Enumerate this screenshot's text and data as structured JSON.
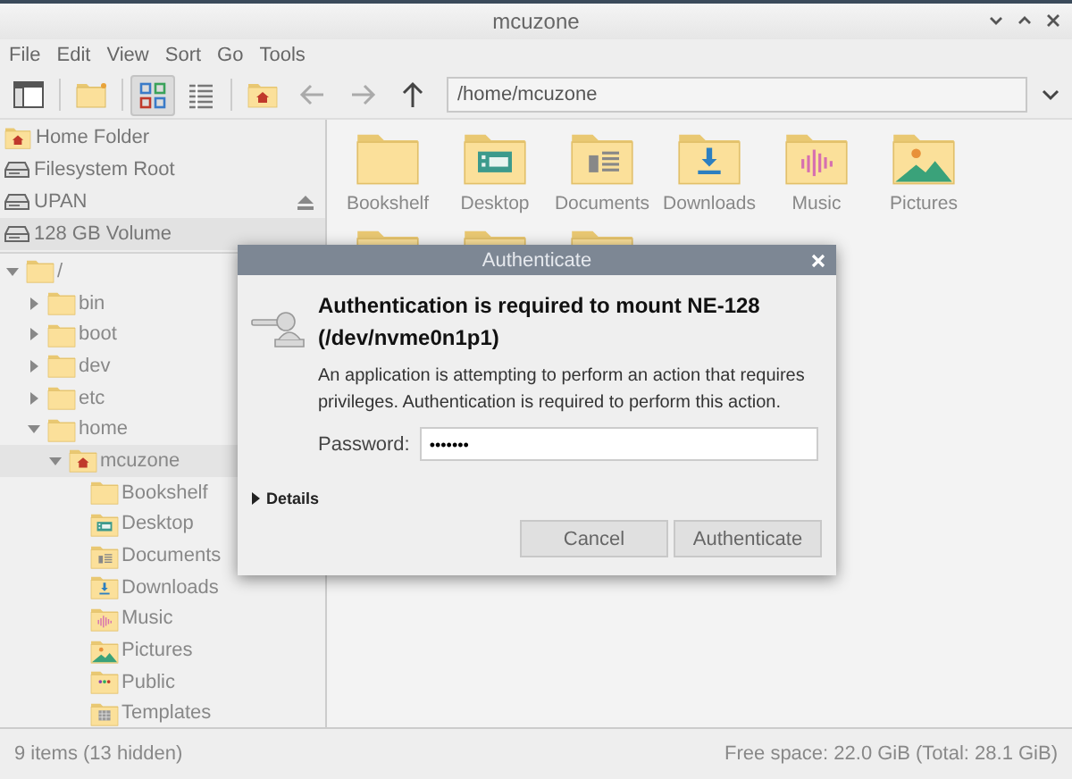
{
  "window": {
    "title": "mcuzone"
  },
  "menu": [
    "File",
    "Edit",
    "View",
    "Sort",
    "Go",
    "Tools"
  ],
  "view_modes": [
    {
      "kind": "icons",
      "selected": true
    },
    {
      "kind": "list",
      "selected": false
    }
  ],
  "nav": [
    {
      "kind": "back",
      "disabled": true
    },
    {
      "kind": "forward",
      "disabled": true
    },
    {
      "kind": "up",
      "disabled": false
    }
  ],
  "location": {
    "value": "/home/mcuzone"
  },
  "places": [
    {
      "label": "Home Folder",
      "kind": "home",
      "selected": false
    },
    {
      "label": "Filesystem Root",
      "kind": "drive",
      "selected": false
    },
    {
      "label": "UPAN",
      "kind": "drive",
      "eject": true,
      "selected": false
    },
    {
      "label": "128 GB Volume",
      "kind": "drive",
      "selected": true
    }
  ],
  "tree": [
    {
      "label": "/",
      "kind": "folder",
      "expanded": true,
      "selected": false,
      "children": [
        {
          "label": "bin",
          "kind": "folder",
          "expanded": false,
          "selected": false
        },
        {
          "label": "boot",
          "kind": "folder",
          "expanded": false,
          "selected": false
        },
        {
          "label": "dev",
          "kind": "folder",
          "expanded": false,
          "selected": false
        },
        {
          "label": "etc",
          "kind": "folder",
          "expanded": false,
          "selected": false
        },
        {
          "label": "home",
          "kind": "folder",
          "expanded": true,
          "selected": false,
          "children": [
            {
              "label": "mcuzone",
              "kind": "home",
              "expanded": true,
              "selected": true,
              "children": [
                {
                  "label": "Bookshelf",
                  "kind": "folder",
                  "selected": false
                },
                {
                  "label": "Desktop",
                  "kind": "desktop",
                  "selected": false
                },
                {
                  "label": "Documents",
                  "kind": "documents",
                  "selected": false
                },
                {
                  "label": "Downloads",
                  "kind": "downloads",
                  "selected": false
                },
                {
                  "label": "Music",
                  "kind": "music",
                  "selected": false
                },
                {
                  "label": "Pictures",
                  "kind": "pictures",
                  "selected": false
                },
                {
                  "label": "Public",
                  "kind": "public",
                  "selected": false
                },
                {
                  "label": "Templates",
                  "kind": "templates",
                  "selected": false
                }
              ]
            }
          ]
        }
      ]
    }
  ],
  "files": [
    {
      "label": "Bookshelf",
      "kind": "folder"
    },
    {
      "label": "Desktop",
      "kind": "desktop"
    },
    {
      "label": "Documents",
      "kind": "documents"
    },
    {
      "label": "Downloads",
      "kind": "downloads"
    },
    {
      "label": "Music",
      "kind": "music"
    },
    {
      "label": "Pictures",
      "kind": "pictures"
    },
    {
      "kind": "public"
    },
    {
      "kind": "templates"
    },
    {
      "kind": "emblem"
    }
  ],
  "status_bar": {
    "left": "9 items (13 hidden)",
    "right": "Free space: 22.0 GiB (Total: 28.1 GiB)"
  },
  "dialog": {
    "title": "Authenticate",
    "heading": "Authentication is required to mount NE-128 (/dev/nvme0n1p1)",
    "message": "An application is attempting to perform an action that requires privileges. Authentication is required to perform this action.",
    "password_label": "Password:",
    "password_value": "•••••••",
    "details": {
      "label": "Details",
      "expanded": false
    },
    "buttons": [
      "Cancel",
      "Authenticate"
    ]
  }
}
